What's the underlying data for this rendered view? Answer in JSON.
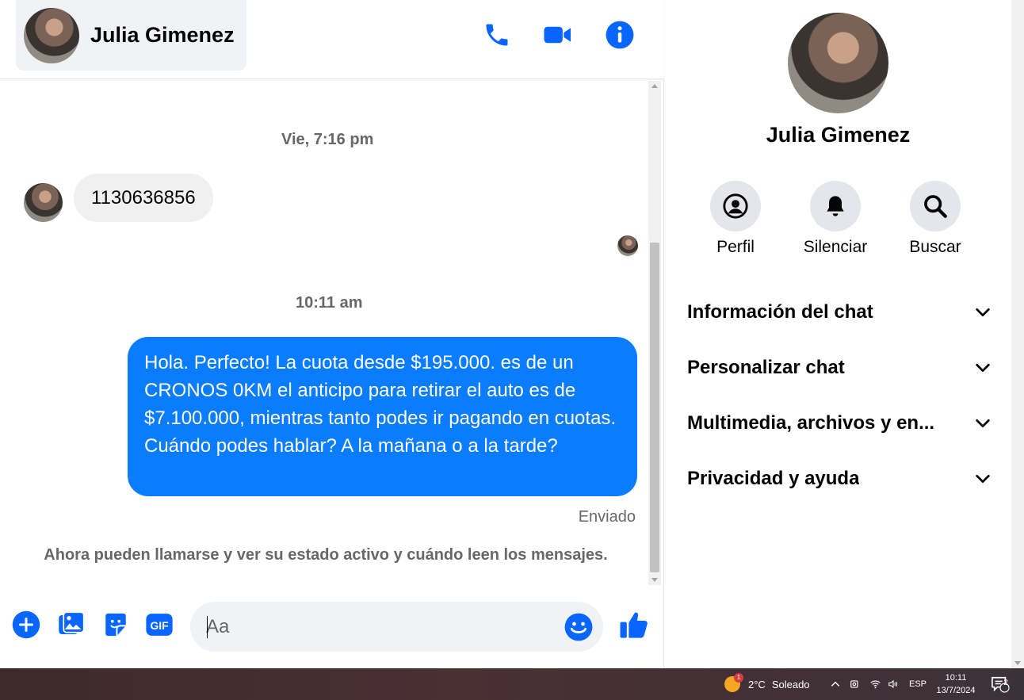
{
  "header": {
    "contact_name": "Julia Gimenez"
  },
  "conversation": {
    "timestamp_1": "Vie, 7:16 pm",
    "incoming_message": "1130636856",
    "timestamp_2": "10:11 am",
    "outgoing_message": "Hola. Perfecto! La cuota desde $195.000. es de un CRONOS 0KM el anticipo para retirar el auto es de $7.100.000, mientras tanto podes ir pagando en cuotas. Cuándo podes hablar? A la mañana o a la tarde?",
    "status": "Enviado",
    "notice": "Ahora pueden llamarse y ver su estado activo y cuándo leen los mensajes."
  },
  "composer": {
    "placeholder": "Aa"
  },
  "info_panel": {
    "name": "Julia Gimenez",
    "actions": [
      {
        "label": "Perfil",
        "icon": "profile-icon"
      },
      {
        "label": "Silenciar",
        "icon": "bell-icon"
      },
      {
        "label": "Buscar",
        "icon": "search-icon"
      }
    ],
    "sections": [
      {
        "label": "Información del chat"
      },
      {
        "label": "Personalizar chat"
      },
      {
        "label": "Multimedia, archivos y en..."
      },
      {
        "label": "Privacidad y ayuda"
      }
    ]
  },
  "taskbar": {
    "weather_badge": "1",
    "weather": "2°C",
    "weather_desc": "Soleado",
    "language": "ESP",
    "time": "10:11",
    "date": "13/7/2024",
    "notifications": "2"
  },
  "colors": {
    "accent": "#0a7cff",
    "icon_blue": "#0866ff"
  }
}
